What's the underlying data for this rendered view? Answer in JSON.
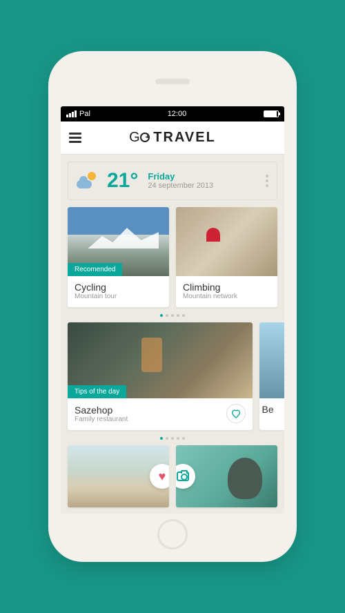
{
  "status": {
    "carrier": "Pal",
    "time": "12:00"
  },
  "header": {
    "brand_go": "G",
    "brand_travel": "TRAVEL"
  },
  "weather": {
    "temp": "21°",
    "day": "Friday",
    "date": "24 september 2013"
  },
  "featured": [
    {
      "badge": "Recomended",
      "title": "Cycling",
      "subtitle": "Mountain tour"
    },
    {
      "badge": "",
      "title": "Climbing",
      "subtitle": "Mountain network"
    }
  ],
  "tip": {
    "badge": "Tips of the day",
    "title": "Sazehop",
    "subtitle": "Family restaurant",
    "peek_title": "Be"
  },
  "icons": {
    "menu": "menu-icon",
    "weather": "sun-cloud-icon",
    "more": "more-vertical-icon",
    "heart_outline": "heart-outline-icon",
    "heart_fill": "heart-fill-icon",
    "camera": "camera-icon"
  },
  "colors": {
    "accent": "#0aa89b",
    "background": "#189687",
    "heart": "#e2546a"
  }
}
